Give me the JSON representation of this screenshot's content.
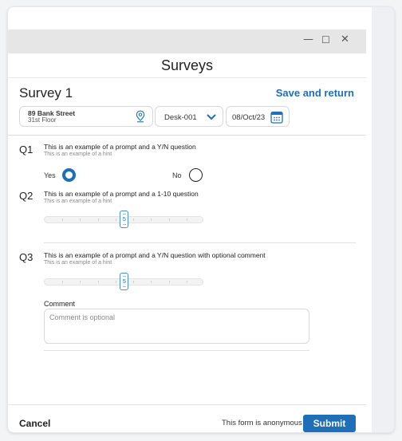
{
  "window": {
    "controls": {
      "minimize": "—",
      "maximize": "☐",
      "close": "✕"
    }
  },
  "header": {
    "title": "Surveys"
  },
  "survey": {
    "title": "Survey 1",
    "save_return": "Save and return",
    "location": {
      "line1": "89 Bank Street",
      "line2": "31st Floor",
      "icon": "location-pin-icon"
    },
    "desk": {
      "value": "Desk-001",
      "icon": "chevron-down-icon"
    },
    "date": {
      "value": "08/Oct/23",
      "icon": "calendar-icon"
    }
  },
  "questions": [
    {
      "number": "Q1",
      "prompt": "This is an example of a prompt and a Y/N question",
      "hint": "This is an example of a hint",
      "type": "yes-no",
      "yes_label": "Yes",
      "no_label": "No",
      "selected": "Yes"
    },
    {
      "number": "Q2",
      "prompt": "This is an example of a prompt and a 1-10 question",
      "hint": "This is an example of a hint",
      "type": "scale",
      "min": 1,
      "max": 10,
      "value": 5,
      "value_label": "5"
    },
    {
      "number": "Q3",
      "prompt": "This is an example of a prompt and a Y/N question with optional comment",
      "hint": "This is an example of a hint",
      "type": "scale-comment",
      "min": 1,
      "max": 10,
      "value": 5,
      "value_label": "5",
      "comment_label": "Comment",
      "comment_placeholder": "Comment is optional",
      "comment_value": ""
    }
  ],
  "footer": {
    "cancel": "Cancel",
    "anonymous_note": "This form is anonymous",
    "submit": "Submit"
  },
  "colors": {
    "accent": "#1f6fb8",
    "titlebar": "#e6e6e6",
    "background": "#f3f4f6"
  }
}
